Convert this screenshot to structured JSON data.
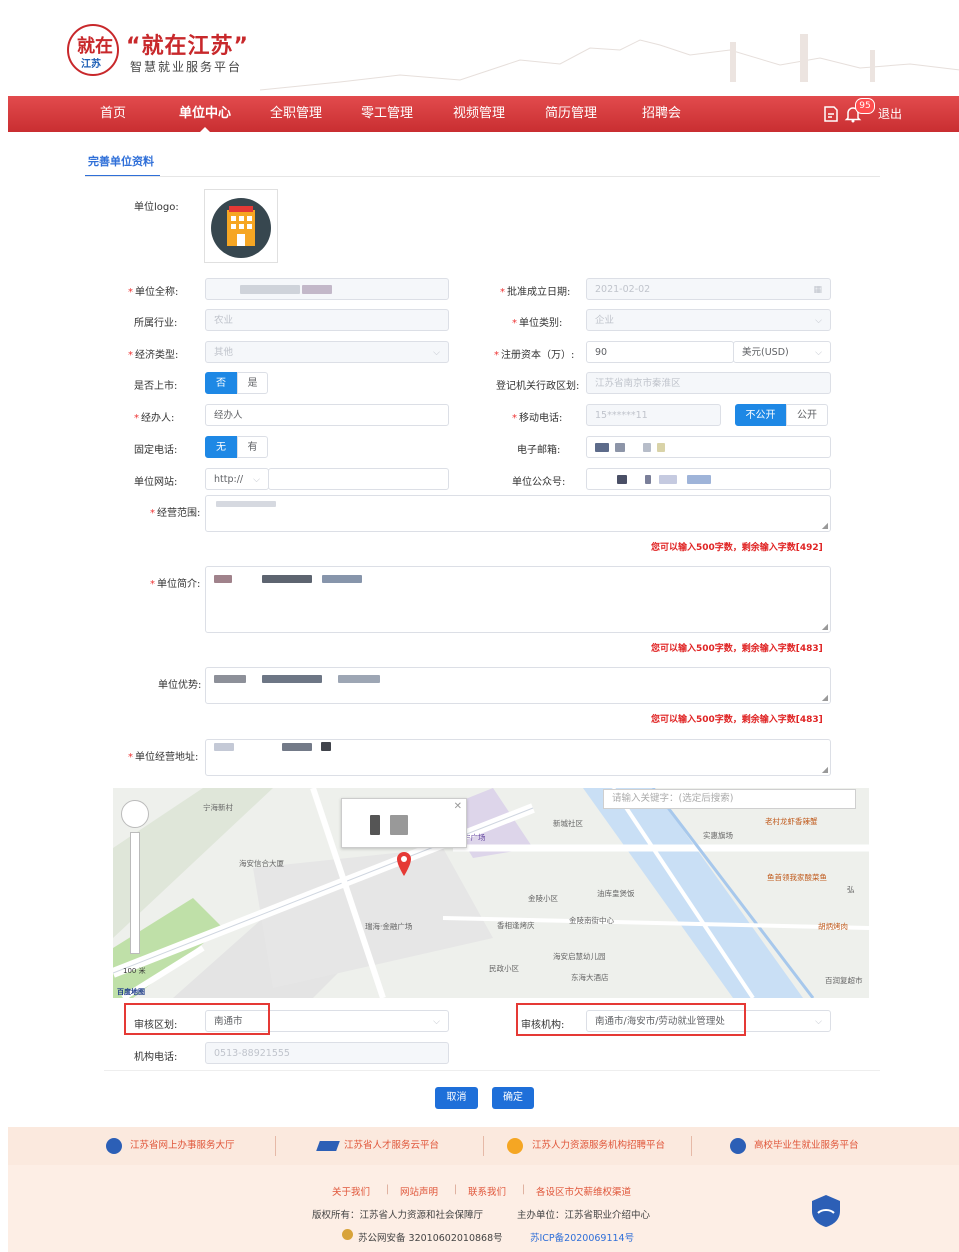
{
  "site": {
    "logo_char1": "就在",
    "logo_char2": "江苏",
    "title": "“就在江苏”",
    "subtitle": "智慧就业服务平台"
  },
  "nav": {
    "items": [
      "首页",
      "单位中心",
      "全职管理",
      "零工管理",
      "视频管理",
      "简历管理",
      "招聘会"
    ],
    "active": "单位中心",
    "message_count": "95",
    "logout": "退出"
  },
  "tab": {
    "label": "完善单位资料"
  },
  "form": {
    "logo_label": "单位logo:",
    "full_name_label": "单位全称:",
    "approval_date_label": "批准成立日期:",
    "approval_date_value": "2021-02-02",
    "industry_label": "所属行业:",
    "industry_value": "农业",
    "unit_type_label": "单位类别:",
    "unit_type_value": "企业",
    "econ_type_label": "经济类型:",
    "econ_type_value": "其他",
    "reg_capital_label": "注册资本（万）:",
    "reg_capital_value": "90",
    "currency_value": "美元(USD)",
    "listed_label": "是否上市:",
    "listed_no": "否",
    "listed_yes": "是",
    "reg_authority_label": "登记机关行政区划:",
    "reg_authority_value": "江苏省南京市秦淮区",
    "agent_label": "经办人:",
    "agent_value": "经办人",
    "mobile_label": "移动电话:",
    "mobile_value": "15******11",
    "mobile_private": "不公开",
    "mobile_public": "公开",
    "landline_label": "固定电话:",
    "landline_no": "无",
    "landline_yes": "有",
    "email_label": "电子邮箱:",
    "website_label": "单位网站:",
    "website_protocol": "http://",
    "wechat_label": "单位公众号:",
    "scope_label": "经营范围:",
    "scope_hint": "您可以输入500字数，剩余输入字数[492]",
    "intro_label": "单位简介:",
    "intro_hint": "您可以输入500字数，剩余输入字数[483]",
    "advantage_label": "单位优势:",
    "advantage_hint": "您可以输入500字数，剩余输入字数[483]",
    "address_label": "单位经营地址:",
    "review_region_label": "审核区划:",
    "review_region_value": "南通市",
    "review_org_label": "审核机构:",
    "review_org_value": "南通市/海安市/劳动就业管理处",
    "org_phone_label": "机构电话:",
    "org_phone_value": "0513-88921555"
  },
  "map": {
    "search_placeholder": "请输入关键字：(选定后搜索)",
    "labels": [
      "宁海新村",
      "海安信合大厦",
      "瑞海·金融广场",
      "金陵小区",
      "金陵南街中心",
      "海安启慧幼儿园",
      "东海大酒店",
      "民政小区",
      "实惠旗场",
      "鱼首领我家酸菜鱼",
      "百润复超市",
      "老村龙虾香辣蟹",
      "胡炳烤肉",
      "新城社区",
      "宁广场",
      "油库皇煲饭",
      "香相逢烤庆",
      "弘"
    ],
    "scale": "100 米",
    "brand": "百度地图"
  },
  "buttons": {
    "cancel": "取消",
    "confirm": "确定"
  },
  "footer": {
    "links": [
      "江苏省网上办事服务大厅",
      "江苏省人才服务云平台",
      "江苏人力资源服务机构招聘平台",
      "高校毕业生就业服务平台"
    ],
    "bottom_links": [
      "关于我们",
      "网站声明",
      "联系我们",
      "各设区市欠薪维权渠道"
    ],
    "copyright": "版权所有：江苏省人力资源和社会保障厅",
    "sponsor": "主办单位：江苏省职业介绍中心",
    "police": "苏公网安备 32010602010868号",
    "icp": "苏ICP备2020069114号"
  },
  "colors": {
    "brand_red": "#c8282b",
    "primary_blue": "#1e6fd9",
    "hint_red": "#e02424"
  }
}
